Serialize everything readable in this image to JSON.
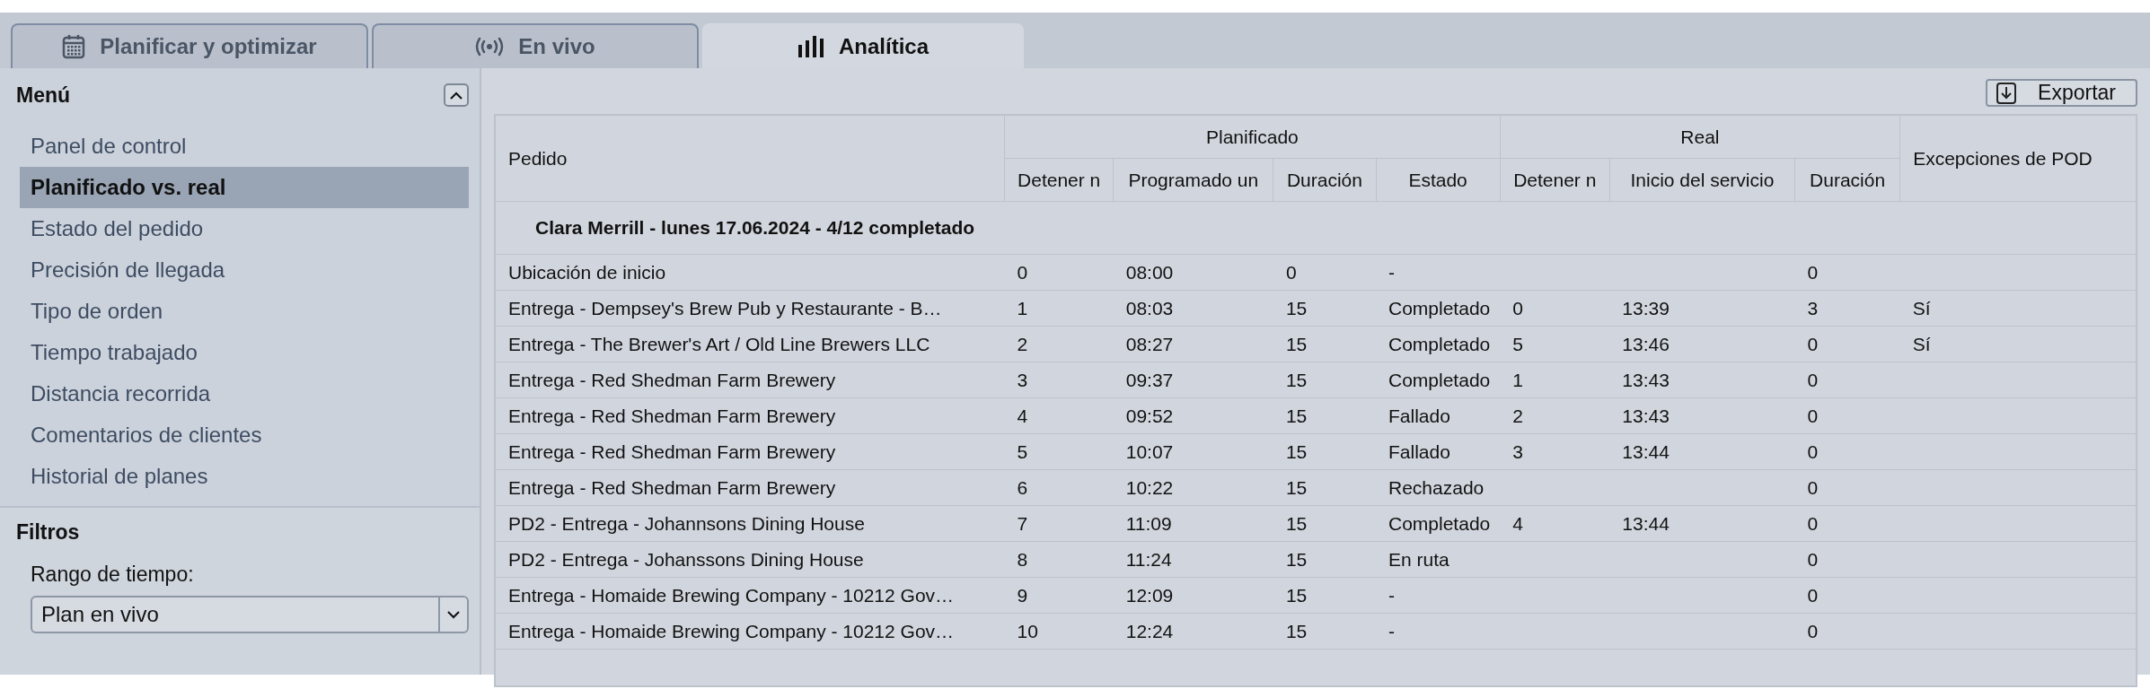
{
  "tabs": [
    {
      "label": "Planificar y optimizar",
      "selected": false
    },
    {
      "label": "En vivo",
      "selected": false
    },
    {
      "label": "Analítica",
      "selected": true
    }
  ],
  "sidebar": {
    "title": "Menú",
    "items": [
      {
        "label": "Panel de control",
        "selected": false
      },
      {
        "label": "Planificado vs. real",
        "selected": true
      },
      {
        "label": "Estado del pedido",
        "selected": false
      },
      {
        "label": "Precisión de llegada",
        "selected": false
      },
      {
        "label": "Tipo de orden",
        "selected": false
      },
      {
        "label": "Tiempo trabajado",
        "selected": false
      },
      {
        "label": "Distancia recorrida",
        "selected": false
      },
      {
        "label": "Comentarios de clientes",
        "selected": false
      },
      {
        "label": "Historial de planes",
        "selected": false
      }
    ],
    "filters": {
      "title": "Filtros",
      "label": "Rango de tiempo:",
      "value": "Plan en vivo"
    }
  },
  "export_button": "Exportar",
  "table": {
    "order_column": "Pedido",
    "groups": [
      {
        "label": "Planificado",
        "columns": [
          "Detener n",
          "Programado un",
          "Duración",
          "Estado"
        ]
      },
      {
        "label": "Real",
        "columns": [
          "Detener n",
          "Inicio del servicio",
          "Duración"
        ]
      }
    ],
    "pod_column": "Excepciones de POD",
    "group_title": "Clara Merrill - lunes 17.06.2024 - 4/12 completado",
    "rows": [
      {
        "pedido": "Ubicación de inicio",
        "plan_stop": "0",
        "plan_time": "08:00",
        "plan_duration": "0",
        "plan_status": "-",
        "real_duration": "0"
      },
      {
        "pedido": "Entrega - Dempsey's Brew Pub y Restaurante - B…",
        "plan_stop": "1",
        "plan_time": "08:03",
        "plan_duration": "15",
        "plan_status": "Completado",
        "real_stop": "0",
        "real_start": "13:39",
        "real_duration": "3",
        "pod_exceptions": "Sí"
      },
      {
        "pedido": "Entrega - The Brewer's Art / Old Line Brewers LLC",
        "plan_stop": "2",
        "plan_time": "08:27",
        "plan_duration": "15",
        "plan_status": "Completado",
        "real_stop": "5",
        "real_start": "13:46",
        "real_duration": "0",
        "pod_exceptions": "Sí"
      },
      {
        "pedido": "Entrega - Red Shedman Farm Brewery",
        "plan_stop": "3",
        "plan_time": "09:37",
        "plan_duration": "15",
        "plan_status": "Completado",
        "real_stop": "1",
        "real_start": "13:43",
        "real_duration": "0"
      },
      {
        "pedido": "Entrega - Red Shedman Farm Brewery",
        "plan_stop": "4",
        "plan_time": "09:52",
        "plan_duration": "15",
        "plan_status": "Fallado",
        "real_stop": "2",
        "real_start": "13:43",
        "real_duration": "0"
      },
      {
        "pedido": "Entrega - Red Shedman Farm Brewery",
        "plan_stop": "5",
        "plan_time": "10:07",
        "plan_duration": "15",
        "plan_status": "Fallado",
        "real_stop": "3",
        "real_start": "13:44",
        "real_duration": "0"
      },
      {
        "pedido": "Entrega - Red Shedman Farm Brewery",
        "plan_stop": "6",
        "plan_time": "10:22",
        "plan_duration": "15",
        "plan_status": "Rechazado",
        "real_duration": "0"
      },
      {
        "pedido": "PD2 - Entrega - Johannsons Dining House",
        "plan_stop": "7",
        "plan_time": "11:09",
        "plan_duration": "15",
        "plan_status": "Completado",
        "real_stop": "4",
        "real_start": "13:44",
        "real_duration": "0"
      },
      {
        "pedido": "PD2 - Entrega - Johanssons Dining House",
        "plan_stop": "8",
        "plan_time": "11:24",
        "plan_duration": "15",
        "plan_status": "En ruta",
        "real_duration": "0"
      },
      {
        "pedido": "Entrega - Homaide Brewing Company - 10212 Gov…",
        "plan_stop": "9",
        "plan_time": "12:09",
        "plan_duration": "15",
        "plan_status": "-",
        "real_duration": "0"
      },
      {
        "pedido": "Entrega - Homaide Brewing Company - 10212 Gov…",
        "plan_stop": "10",
        "plan_time": "12:24",
        "plan_duration": "15",
        "plan_status": "-",
        "real_duration": "0"
      }
    ]
  }
}
